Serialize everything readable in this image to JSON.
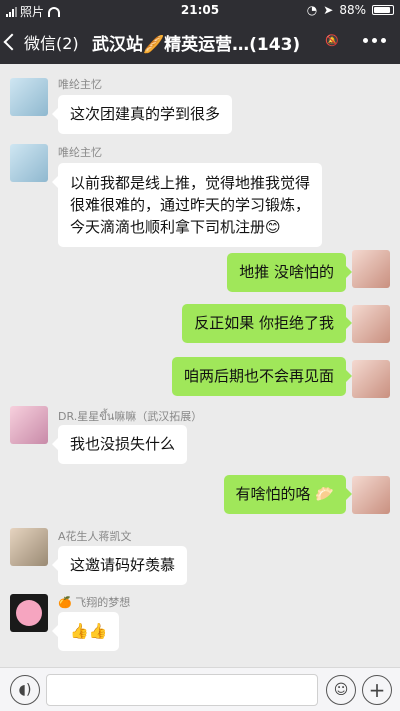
{
  "status": {
    "carrier": "照片",
    "time": "21:05",
    "battery": "88%"
  },
  "nav": {
    "back_label": "微信(2)",
    "title": "武汉站🥖精英运营…(143)"
  },
  "messages": [
    {
      "dir": "in",
      "sender": "唯纶主忆",
      "text": "这次团建真的学到很多"
    },
    {
      "dir": "in",
      "sender": "唯纶主忆",
      "lines": [
        "以前我都是线上推，觉得地推我觉得",
        "很难很难的，通过昨天的学习锻炼，",
        "今天滴滴也顺利拿下司机注册😊"
      ]
    },
    {
      "dir": "out",
      "text": "地推  没啥怕的"
    },
    {
      "dir": "out",
      "text": "反正如果 你拒绝了我"
    },
    {
      "dir": "out",
      "text": "咱两后期也不会再见面"
    },
    {
      "dir": "in",
      "sender": "DR.星星ขึ้น嘛嘛（武汉拓展）",
      "text": "我也没损失什么"
    },
    {
      "dir": "out",
      "text": "有啥怕的咯  🥟"
    },
    {
      "dir": "in",
      "sender": "A花生人蒋凯文",
      "text": "这邀请码好羡慕"
    },
    {
      "dir": "in",
      "sender": "🍊 飞翔的梦想",
      "text": "👍👍"
    }
  ],
  "input": {
    "placeholder": ""
  },
  "icons": {
    "voice": "voice-icon",
    "emoji": "emoji-icon",
    "plus": "plus-icon"
  }
}
